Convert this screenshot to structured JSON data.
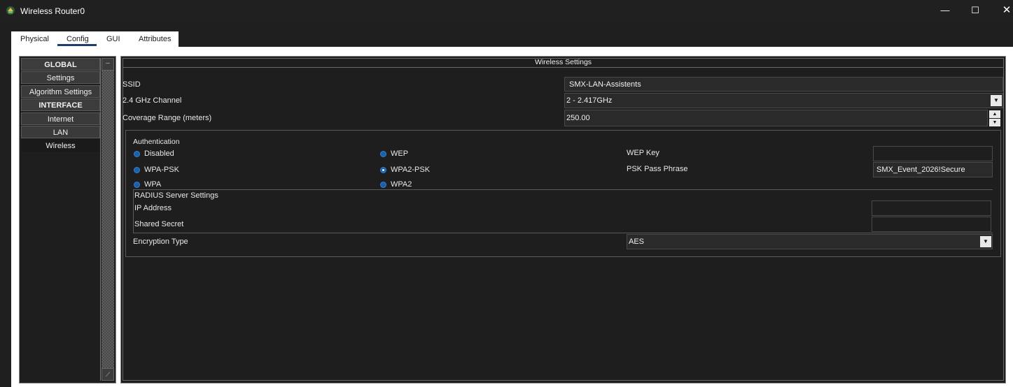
{
  "window": {
    "title": "Wireless Router0",
    "controls": {
      "minimize": "—",
      "maximize": "☐",
      "close": "✕"
    }
  },
  "tabs": [
    {
      "label": "Physical",
      "active": false
    },
    {
      "label": "Config",
      "active": true
    },
    {
      "label": "GUI",
      "active": false
    },
    {
      "label": "Attributes",
      "active": false
    }
  ],
  "sidebar": {
    "items": [
      {
        "label": "GLOBAL",
        "header": true
      },
      {
        "label": "Settings"
      },
      {
        "label": "Algorithm Settings"
      },
      {
        "label": "INTERFACE",
        "header": true
      },
      {
        "label": "Internet"
      },
      {
        "label": "LAN"
      },
      {
        "label": "Wireless",
        "selected": true
      }
    ]
  },
  "wireless": {
    "section_title": "Wireless Settings",
    "ssid_label": "SSID",
    "ssid_value": "SMX-LAN-Assistents",
    "channel_label": "2.4 GHz Channel",
    "channel_value": "2 - 2.417GHz",
    "range_label": "Coverage Range (meters)",
    "range_value": "250.00",
    "auth": {
      "title": "Authentication",
      "options": {
        "disabled": "Disabled",
        "wep": "WEP",
        "wpa_psk": "WPA-PSK",
        "wpa2_psk": "WPA2-PSK",
        "wpa": "WPA",
        "wpa2": "WPA2"
      },
      "selected": "WPA2-PSK",
      "wep_key_label": "WEP Key",
      "wep_key_value": "",
      "psk_label": "PSK Pass Phrase",
      "psk_value": "SMX_Event_2026!Secure"
    },
    "radius": {
      "title": "RADIUS Server Settings",
      "ip_label": "IP Address",
      "ip_value": "",
      "secret_label": "Shared Secret",
      "secret_value": ""
    },
    "encryption_label": "Encryption Type",
    "encryption_value": "AES"
  },
  "colors": {
    "radio_blue": "#1a5fa8",
    "tab_underline": "#1c3f70",
    "panel_bg": "#1e1e1e"
  }
}
